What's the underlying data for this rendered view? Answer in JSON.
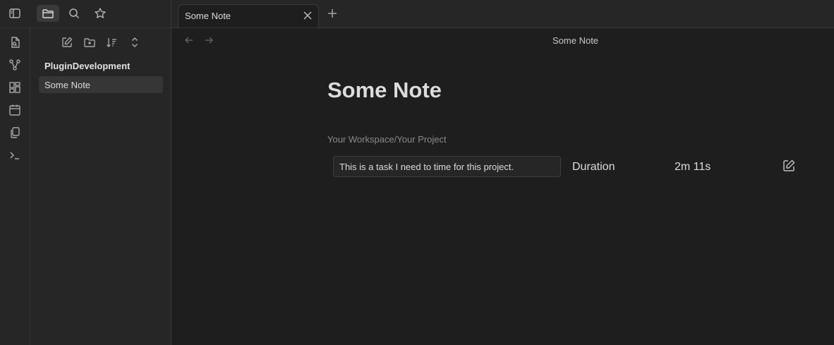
{
  "tab": {
    "title": "Some Note"
  },
  "explorer": {
    "vault_name": "PluginDevelopment",
    "files": [
      {
        "label": "Some Note"
      }
    ]
  },
  "view": {
    "header_title": "Some Note"
  },
  "note": {
    "title": "Some Note",
    "path": "Your Workspace/Your Project",
    "timer": {
      "task_text": "This is a task I need to time for this project.",
      "duration_label": "Duration",
      "duration_value": "2m 11s"
    }
  },
  "icons": {
    "topbar": [
      "sidebar-toggle-icon",
      "folder-icon",
      "search-icon",
      "star-icon"
    ],
    "ribbon": [
      "file-search-icon",
      "graph-icon",
      "canvas-icon",
      "calendar-icon",
      "copy-icon",
      "terminal-icon"
    ],
    "explorer_toolbar": [
      "new-note-icon",
      "new-folder-icon",
      "sort-icon",
      "collapse-icon"
    ]
  },
  "colors": {
    "background": "#1e1e1e",
    "panel": "#262626",
    "active_item": "#363636"
  }
}
